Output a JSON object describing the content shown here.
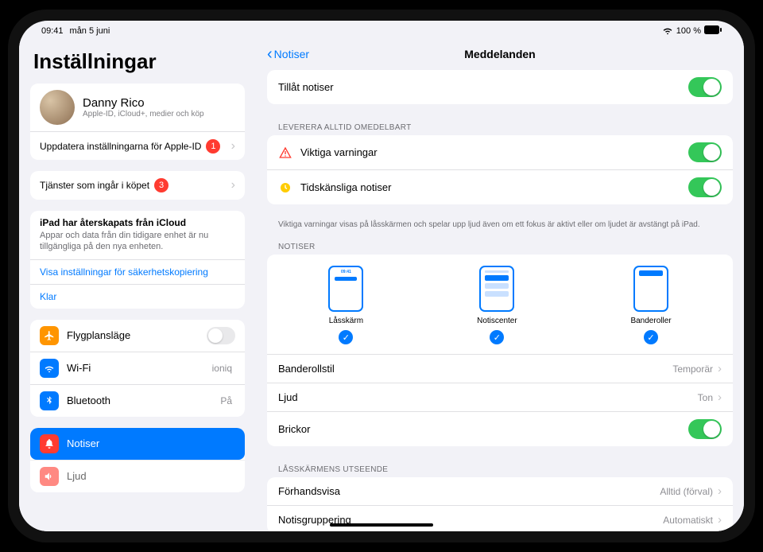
{
  "status": {
    "time": "09:41",
    "date": "mån 5 juni",
    "battery": "100 %"
  },
  "sidebar": {
    "title": "Inställningar",
    "account": {
      "name": "Danny Rico",
      "sub": "Apple-ID, iCloud+, medier och köp"
    },
    "update_row": {
      "label": "Uppdatera inställningarna för Apple-ID",
      "badge": "1"
    },
    "services_row": {
      "label": "Tjänster som ingår i köpet",
      "badge": "3"
    },
    "restore": {
      "title": "iPad har återskapats från iCloud",
      "text": "Appar och data från din tidigare enhet är nu tillgängliga på den nya enheten.",
      "link1": "Visa inställningar för säkerhetskopiering",
      "link2": "Klar"
    },
    "items": {
      "airplane": "Flygplansläge",
      "wifi": "Wi-Fi",
      "wifi_val": "ioniq",
      "bt": "Bluetooth",
      "bt_val": "På",
      "notif": "Notiser",
      "sound": "Ljud"
    }
  },
  "main": {
    "back": "Notiser",
    "title": "Meddelanden",
    "allow": "Tillåt notiser",
    "deliver_header": "LEVERERA ALLTID OMEDELBART",
    "critical": "Viktiga varningar",
    "timesensitive": "Tidskänsliga notiser",
    "footer1": "Viktiga varningar visas på låsskärmen och spelar upp ljud även om ett fokus är aktivt eller om ljudet är avstängt på iPad.",
    "notis_header": "NOTISER",
    "alerts": {
      "lock": "Låsskärm",
      "nc": "Notiscenter",
      "banner": "Banderoller",
      "preview_time": "09:41"
    },
    "bannerstyle": {
      "label": "Banderollstil",
      "value": "Temporär"
    },
    "sound": {
      "label": "Ljud",
      "value": "Ton"
    },
    "badges": "Brickor",
    "appearance_header": "LÅSSKÄRMENS UTSEENDE",
    "preview": {
      "label": "Förhandsvisa",
      "value": "Alltid (förval)"
    },
    "grouping": {
      "label": "Notisgruppering",
      "value": "Automatiskt"
    }
  }
}
